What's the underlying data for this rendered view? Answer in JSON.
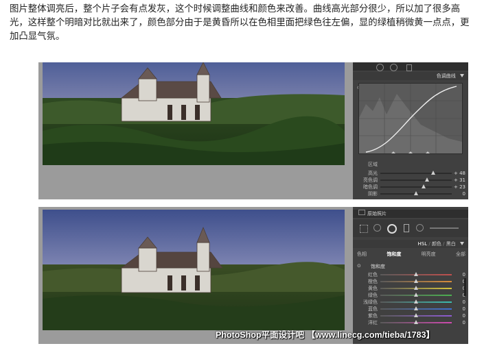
{
  "intro": {
    "line1": "图片整体调亮后，整个片子会有点发灰，这个时候调整曲线和颜色来改善。曲线高光部分很少，所以加了很多高",
    "line2": "光，这样整个明暗对比就出来了，颜色部分由于是黄昏所以在色相里面把绿色往左偏，显的绿植稍微黄一点点，更",
    "line3": "加凸显气氛。"
  },
  "panel1": {
    "title": "色调曲线",
    "region_label": "区域",
    "sliders": [
      {
        "label": "高光",
        "value": "+ 48",
        "level": 0.74
      },
      {
        "label": "亮色调",
        "value": "+ 31",
        "level": 0.65
      },
      {
        "label": "暗色调",
        "value": "+ 23",
        "level": 0.61
      },
      {
        "label": "阴影",
        "value": "0",
        "level": 0.5
      }
    ]
  },
  "panel2": {
    "original_label": "原始照片",
    "section_title": "HSL / 颜色 / 黑白",
    "hsl_label": "HSL",
    "color_label": "颜色",
    "bw_label": "黑白",
    "tabs": [
      "色相",
      "饱和度",
      "明亮度",
      "全部"
    ],
    "active_tab": 1,
    "subtitle": "饱和度",
    "sliders": [
      {
        "label": "红色",
        "value": "0",
        "color": "#c0504d"
      },
      {
        "label": "橙色",
        "value": "0",
        "color": "#d98c3a"
      },
      {
        "label": "黄色",
        "value": "0",
        "color": "#d8c43b"
      },
      {
        "label": "绿色",
        "value": "0",
        "color": "#4caf50"
      },
      {
        "label": "浅绿色",
        "value": "0",
        "color": "#3bbdb0"
      },
      {
        "label": "蓝色",
        "value": "0",
        "color": "#3f6fd1"
      },
      {
        "label": "紫色",
        "value": "0",
        "color": "#8e5bd3"
      },
      {
        "label": "洋红",
        "value": "0",
        "color": "#d04ab0"
      }
    ]
  },
  "watermark": "PhotoShop平面设计吧 【www.linecg.com/tieba/1783】"
}
